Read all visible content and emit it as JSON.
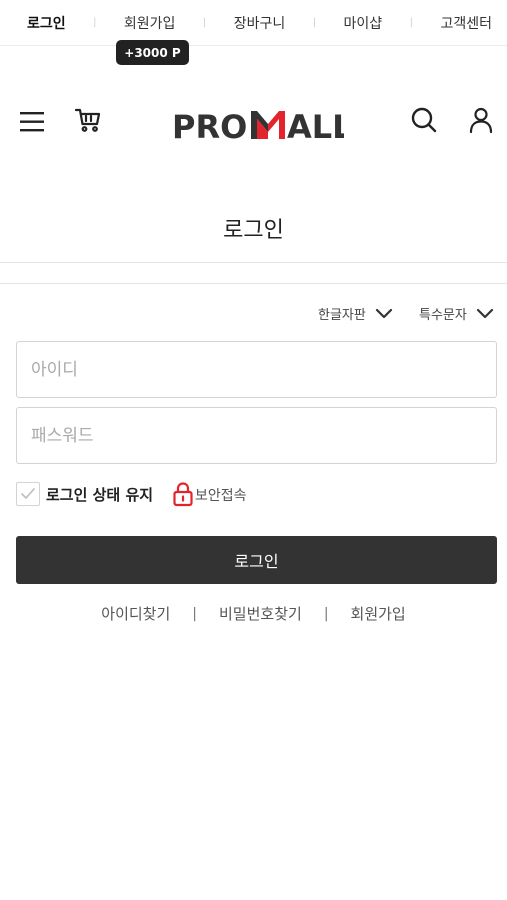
{
  "top_nav": {
    "items": [
      "로그인",
      "회원가입",
      "장바구니",
      "마이샵",
      "고객센터"
    ],
    "separator": "|"
  },
  "point_badge": "+3000 P",
  "logo": {
    "part1": "PRO",
    "part2": "ALL",
    "accent_color": "#e4242c",
    "text_color": "#333333"
  },
  "page_title": "로그인",
  "keyboard_options": {
    "hangul": "한글자판",
    "special": "특수문자"
  },
  "form": {
    "id_placeholder": "아이디",
    "password_placeholder": "패스워드",
    "remember_label": "로그인 상태 유지",
    "secure_label": "보안접속",
    "login_button": "로그인"
  },
  "links": {
    "find_id": "아이디찾기",
    "find_password": "비밀번호찾기",
    "signup": "회원가입",
    "divider": "|"
  },
  "colors": {
    "primary_button": "#333333",
    "secure_icon": "#e4242c"
  },
  "icons": {
    "menu": "hamburger-menu-icon",
    "cart": "cart-icon",
    "search": "search-icon",
    "user": "user-icon",
    "lock": "lock-icon",
    "chevron": "chevron-down-icon",
    "check": "check-icon"
  }
}
